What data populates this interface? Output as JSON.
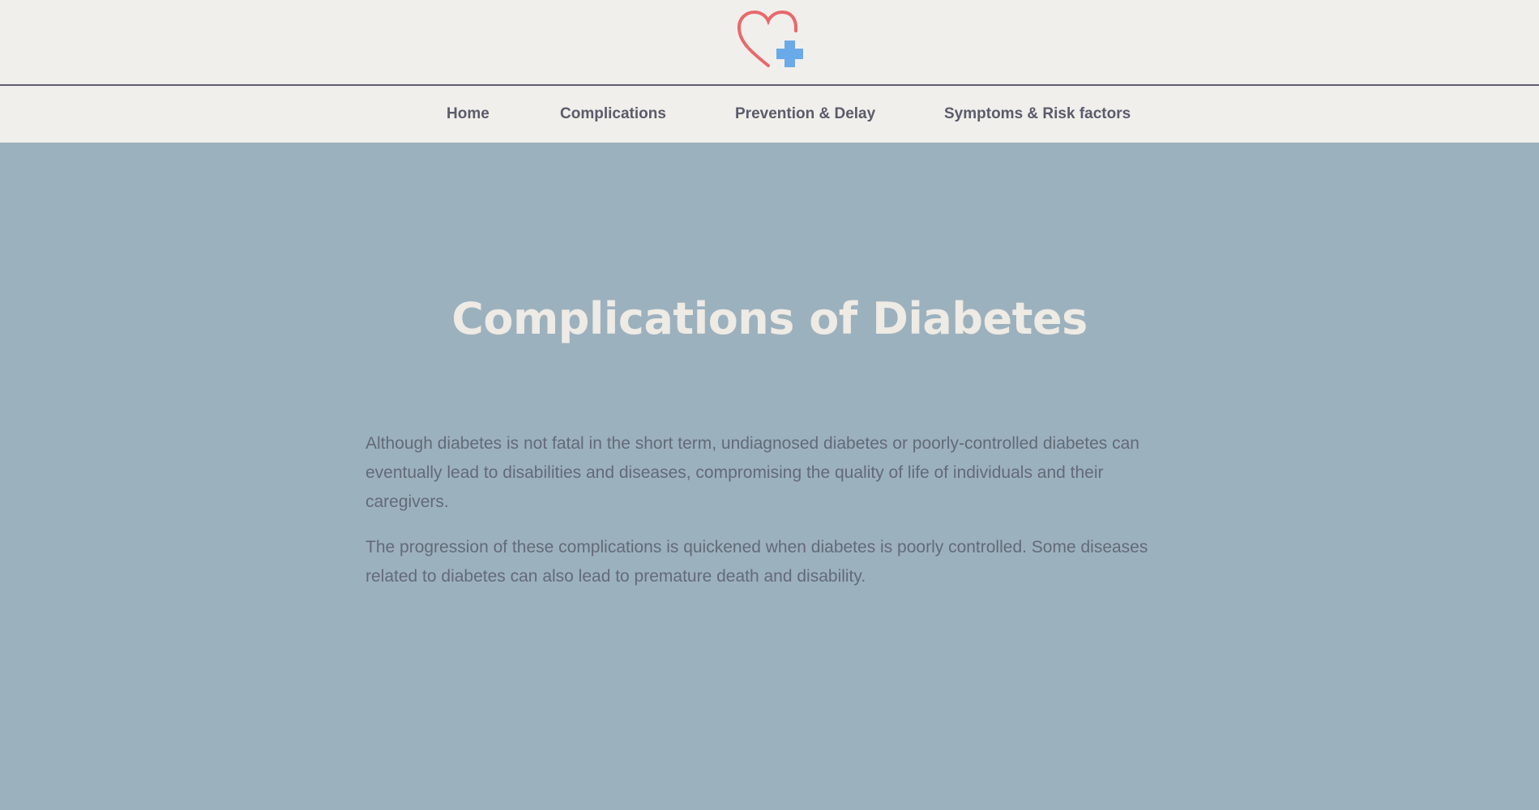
{
  "logo": {
    "icon": "heart-plus-icon",
    "heart_color": "#e8696b",
    "plus_color": "#6aaae8"
  },
  "nav": {
    "items": [
      {
        "label": "Home"
      },
      {
        "label": "Complications"
      },
      {
        "label": "Prevention & Delay"
      },
      {
        "label": "Symptoms & Risk factors"
      }
    ]
  },
  "main": {
    "title": "Complications of Diabetes",
    "paragraphs": [
      "Although diabetes is not fatal in the short term, undiagnosed diabetes or poorly-controlled diabetes can eventually lead to disabilities and diseases, compromising the quality of life of individuals and their caregivers.",
      "The progression of these complications is quickened when diabetes is poorly controlled. Some diseases related to diabetes can also lead to premature death and disability."
    ]
  },
  "colors": {
    "header_bg": "#f0efeb",
    "main_bg": "#9cb1be",
    "title_text": "#eeeae4",
    "body_text": "#636a78",
    "nav_text": "#5b5b6b"
  }
}
